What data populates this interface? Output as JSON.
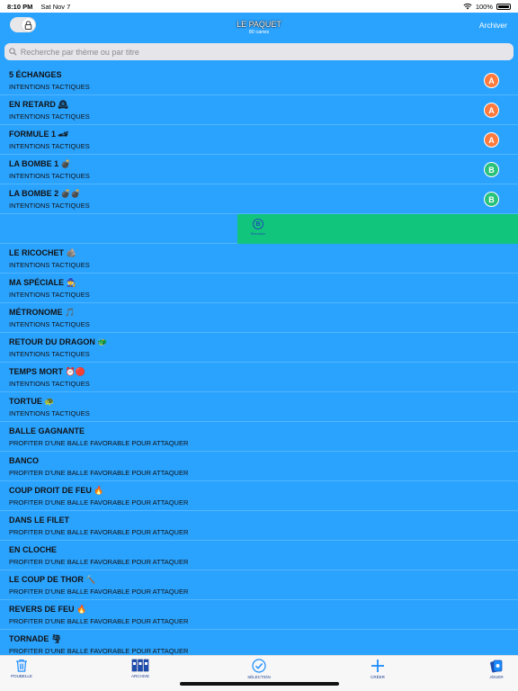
{
  "status": {
    "time": "8:10 PM",
    "date": "Sat Nov 7",
    "battery": "100%"
  },
  "nav": {
    "title": "LE PAQUET",
    "subtitle": "80 cartes",
    "right_label": "Archiver",
    "lock_toggle_on": true
  },
  "search": {
    "placeholder": "Recherche par thème ou par titre",
    "value": ""
  },
  "colors": {
    "list_bg": "#2aa3ff",
    "badge_a": "#ff7a3d",
    "badge_b": "#29c27a",
    "swipe_action": "#12c57d",
    "tab_tint": "#1a8cff"
  },
  "list": {
    "items": [
      {
        "title": "5 ÉCHANGES",
        "subtitle": "INTENTIONS TACTIQUES",
        "badge": "A"
      },
      {
        "title": "EN RETARD 🕰",
        "subtitle": "INTENTIONS TACTIQUES",
        "badge": "A"
      },
      {
        "title": "FORMULE 1 🏎",
        "subtitle": "INTENTIONS TACTIQUES",
        "badge": "A"
      },
      {
        "title": "LA BOMBE 1 💣",
        "subtitle": "INTENTIONS TACTIQUES",
        "badge": "B"
      },
      {
        "title": "LA BOMBE 2 💣💣",
        "subtitle": "INTENTIONS TACTIQUES",
        "badge": "B"
      },
      {
        "title": "",
        "subtitle": "",
        "badge": "",
        "swiped": true,
        "swipe_action_label": "B",
        "swipe_action_caption": "Résolution"
      },
      {
        "title": "LE RICOCHET 🪨",
        "subtitle": "INTENTIONS TACTIQUES",
        "badge": ""
      },
      {
        "title": "MA SPÉCIALE 🧙",
        "subtitle": "INTENTIONS TACTIQUES",
        "badge": ""
      },
      {
        "title": "MÉTRONOME 🎵",
        "subtitle": "INTENTIONS TACTIQUES",
        "badge": ""
      },
      {
        "title": "RETOUR DU DRAGON 🐲",
        "subtitle": "INTENTIONS TACTIQUES",
        "badge": ""
      },
      {
        "title": "TEMPS MORT ⏰🔴",
        "subtitle": "INTENTIONS TACTIQUES",
        "badge": ""
      },
      {
        "title": "TORTUE 🐢",
        "subtitle": "INTENTIONS TACTIQUES",
        "badge": ""
      },
      {
        "title": "BALLE GAGNANTE",
        "subtitle": "PROFITER D'UNE BALLE FAVORABLE POUR ATTAQUER",
        "badge": ""
      },
      {
        "title": "BANCO",
        "subtitle": "PROFITER D'UNE BALLE FAVORABLE POUR ATTAQUER",
        "badge": ""
      },
      {
        "title": "COUP DROIT DE FEU 🔥",
        "subtitle": "PROFITER D'UNE BALLE FAVORABLE POUR ATTAQUER",
        "badge": ""
      },
      {
        "title": "DANS LE FILET",
        "subtitle": "PROFITER D'UNE BALLE FAVORABLE POUR ATTAQUER",
        "badge": ""
      },
      {
        "title": "EN CLOCHE",
        "subtitle": "PROFITER D'UNE BALLE FAVORABLE POUR ATTAQUER",
        "badge": ""
      },
      {
        "title": "LE COUP DE THOR 🔨",
        "subtitle": "PROFITER D'UNE BALLE FAVORABLE POUR ATTAQUER",
        "badge": ""
      },
      {
        "title": "REVERS DE FEU 🔥",
        "subtitle": "PROFITER D'UNE BALLE FAVORABLE POUR ATTAQUER",
        "badge": ""
      },
      {
        "title": "TORNADE 🌪",
        "subtitle": "PROFITER D'UNE BALLE FAVORABLE POUR ATTAQUER",
        "badge": ""
      }
    ]
  },
  "tabbar": {
    "tabs": [
      {
        "id": "poubelle",
        "label": "POUBELLE",
        "icon": "trash-icon"
      },
      {
        "id": "archive",
        "label": "ARCHIVE",
        "icon": "binders-icon"
      },
      {
        "id": "selection",
        "label": "SÉLECTION",
        "icon": "checkmark-circle-icon"
      },
      {
        "id": "creer",
        "label": "CRÉER",
        "icon": "plus-icon"
      },
      {
        "id": "jouer",
        "label": "JOUER",
        "icon": "cards-icon"
      }
    ]
  }
}
